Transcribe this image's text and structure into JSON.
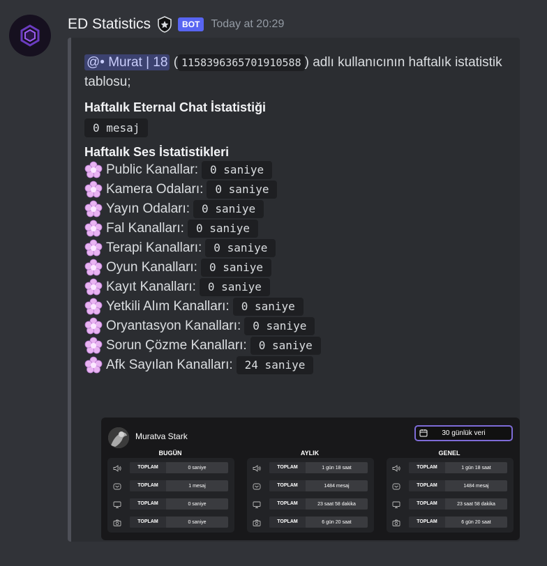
{
  "header": {
    "username": "ED Statistics",
    "bot_tag": "BOT",
    "timestamp": "Today at 20:29"
  },
  "embed": {
    "mention": "@• Murat | 18",
    "user_id": "1158396365701910588",
    "desc_before": "(",
    "desc_after": ") adlı kullanıcının haftalık istatistik tablosu;",
    "chat_title": "Haftalık Eternal Chat İstatistiği",
    "chat_value": "0 mesaj",
    "voice_title": "Haftalık Ses İstatistikleri",
    "voice_stats": [
      {
        "label": "Public Kanallar:",
        "value": "0 saniye"
      },
      {
        "label": "Kamera Odaları:",
        "value": "0 saniye"
      },
      {
        "label": "Yayın Odaları:",
        "value": "0 saniye"
      },
      {
        "label": "Fal Kanalları:",
        "value": "0 saniye"
      },
      {
        "label": "Terapi Kanalları:",
        "value": "0 saniye"
      },
      {
        "label": "Oyun Kanalları:",
        "value": "0 saniye"
      },
      {
        "label": "Kayıt Kanalları:",
        "value": "0 saniye"
      },
      {
        "label": "Yetkili Alım Kanalları:",
        "value": "0 saniye"
      },
      {
        "label": "Oryantasyon Kanalları:",
        "value": "0 saniye"
      },
      {
        "label": "Sorun Çözme Kanalları:",
        "value": "0 saniye"
      },
      {
        "label": "Afk Sayılan Kanalları:",
        "value": "24 saniye"
      }
    ]
  },
  "card": {
    "name": "Muratva Stark",
    "period": "30 günlük veri",
    "sections": [
      {
        "title": "BUGÜN",
        "rows": [
          {
            "label": "TOPLAM",
            "value": "0 saniye"
          },
          {
            "label": "TOPLAM",
            "value": "1 mesaj"
          },
          {
            "label": "TOPLAM",
            "value": "0 saniye"
          },
          {
            "label": "TOPLAM",
            "value": "0 saniye"
          }
        ]
      },
      {
        "title": "AYLIK",
        "rows": [
          {
            "label": "TOPLAM",
            "value": "1 gün 18 saat"
          },
          {
            "label": "TOPLAM",
            "value": "1484 mesaj"
          },
          {
            "label": "TOPLAM",
            "value": "23 saat 58 dakika"
          },
          {
            "label": "TOPLAM",
            "value": "6 gün 20 saat"
          }
        ]
      },
      {
        "title": "GENEL",
        "rows": [
          {
            "label": "TOPLAM",
            "value": "1 gün 18 saat"
          },
          {
            "label": "TOPLAM",
            "value": "1484 mesaj"
          },
          {
            "label": "TOPLAM",
            "value": "23 saat 58 dakika"
          },
          {
            "label": "TOPLAM",
            "value": "6 gün 20 saat"
          }
        ]
      }
    ],
    "row_icons": [
      "speaker-icon",
      "message-icon",
      "monitor-icon",
      "camera-icon"
    ]
  },
  "colors": {
    "background": "#313338",
    "embed": "#2b2d31",
    "bot_tag": "#5865f2",
    "mention_bg": "#3c4270",
    "accent_purple": "#7e6cd8"
  }
}
